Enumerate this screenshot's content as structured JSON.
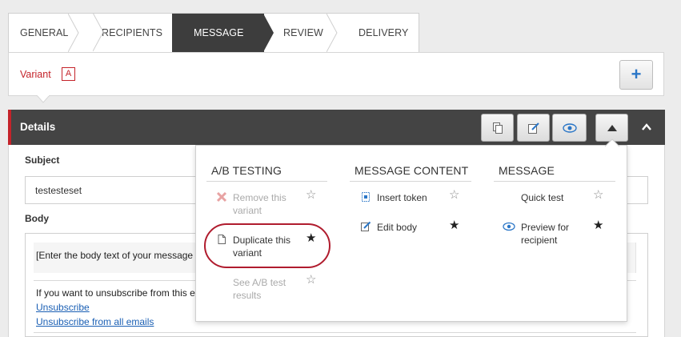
{
  "tabs": [
    {
      "label": "GENERAL"
    },
    {
      "label": "RECIPIENTS"
    },
    {
      "label": "MESSAGE"
    },
    {
      "label": "REVIEW"
    },
    {
      "label": "DELIVERY"
    }
  ],
  "variant": {
    "label": "Variant",
    "value": "A"
  },
  "add_button": {
    "glyph": "+"
  },
  "details": {
    "title": "Details"
  },
  "form": {
    "subject_label": "Subject",
    "subject_value": "testesteset",
    "body_label": "Body",
    "body_placeholder_text": "[Enter the body text of your message",
    "unsubscribe_text": "If you want to unsubscribe from this e",
    "unsubscribe_link": "Unsubscribe",
    "unsubscribe_all_link": "Unsubscribe from all emails"
  },
  "menu": {
    "ab_testing": {
      "title": "A/B TESTING",
      "items": [
        {
          "label": "Remove this variant",
          "icon": "remove-x-icon",
          "enabled": false,
          "favorite": false
        },
        {
          "label": "Duplicate this variant",
          "icon": "duplicate-icon",
          "enabled": true,
          "favorite": true
        },
        {
          "label": "See A/B test results",
          "icon": "",
          "enabled": false,
          "favorite": false
        }
      ]
    },
    "message_content": {
      "title": "MESSAGE CONTENT",
      "items": [
        {
          "label": "Insert token",
          "icon": "token-icon",
          "enabled": true,
          "favorite": false
        },
        {
          "label": "Edit body",
          "icon": "edit-icon",
          "enabled": true,
          "favorite": true
        }
      ]
    },
    "message": {
      "title": "MESSAGE",
      "items": [
        {
          "label": "Quick test",
          "icon": "",
          "enabled": true,
          "favorite": false
        },
        {
          "label": "Preview for recipient",
          "icon": "eye-icon",
          "enabled": true,
          "favorite": true
        }
      ]
    }
  },
  "colors": {
    "accent_red": "#c4232a",
    "header_dark": "#444444",
    "link_blue": "#1a5fb4",
    "add_blue": "#2a76c7"
  }
}
